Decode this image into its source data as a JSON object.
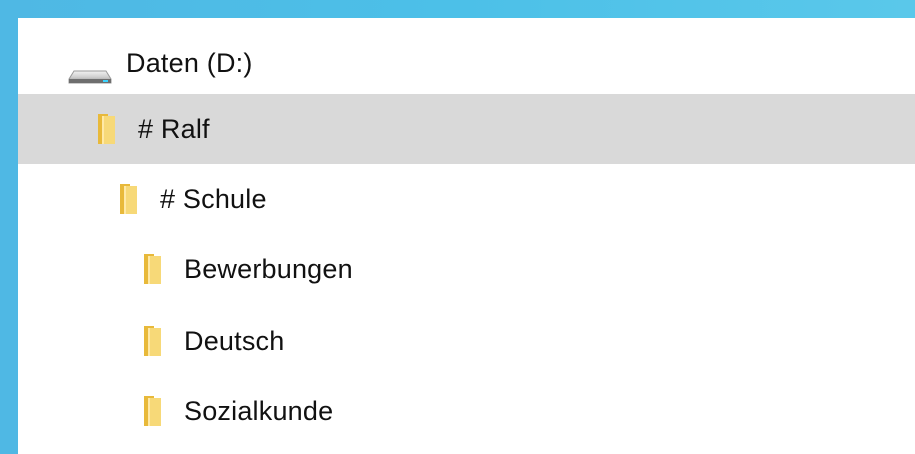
{
  "tree": {
    "drive": {
      "label": "Daten (D:)",
      "icon": "drive-icon"
    },
    "items": [
      {
        "label": "# Ralf",
        "icon": "folder-icon",
        "selected": true
      },
      {
        "label": "# Schule",
        "icon": "folder-icon",
        "selected": false
      },
      {
        "label": "Bewerbungen",
        "icon": "folder-icon",
        "selected": false
      },
      {
        "label": "Deutsch",
        "icon": "folder-icon",
        "selected": false
      },
      {
        "label": "Sozialkunde",
        "icon": "folder-icon",
        "selected": false
      }
    ]
  },
  "colors": {
    "background": "#4cc0e8",
    "panel": "#ffffff",
    "selection": "#d9d9d9",
    "folder": "#f2c94c"
  }
}
